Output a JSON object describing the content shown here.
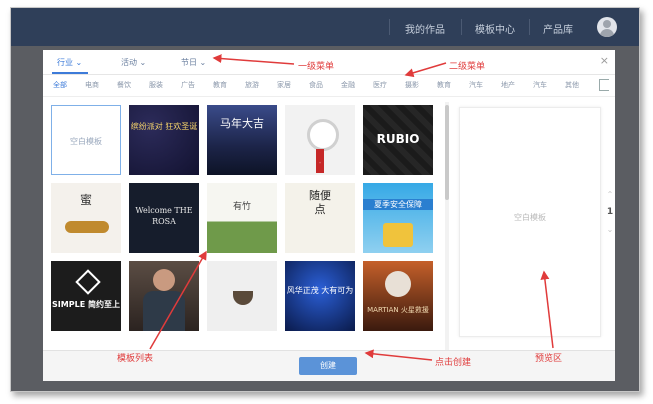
{
  "topnav": {
    "items": [
      "我的作品",
      "模板中心",
      "产品库"
    ],
    "colors": {
      "bg": "#2f3f59",
      "text": "#c7d0dd"
    }
  },
  "modal": {
    "tabs": [
      {
        "label": "行业",
        "arrow": "⌄"
      },
      {
        "label": "活动",
        "arrow": "⌄"
      },
      {
        "label": "节日",
        "arrow": "⌄"
      }
    ],
    "close": "×",
    "categories": [
      "全部",
      "电商",
      "餐饮",
      "服装",
      "广告",
      "教育",
      "旅游",
      "家居",
      "食品",
      "金融",
      "医疗",
      "摄影",
      "教育",
      "汽车",
      "地产",
      "汽车",
      "其他"
    ],
    "templates": [
      {
        "caption": "空白模板"
      },
      {
        "caption": "缤纷派对 狂欢圣诞"
      },
      {
        "caption": "马年大吉"
      },
      {
        "caption": "手表"
      },
      {
        "caption": "RUBIO"
      },
      {
        "caption": "蜜"
      },
      {
        "caption": "Welcome THE ROSA"
      },
      {
        "caption": "有竹"
      },
      {
        "caption": "随便点"
      },
      {
        "caption": "夏季安全保障"
      },
      {
        "caption": "SIMPLE 简约至上"
      },
      {
        "caption": "人物"
      },
      {
        "caption": "茶"
      },
      {
        "caption": "风华正茂 大有可为"
      },
      {
        "caption": "MARTIAN 火星救援"
      }
    ],
    "preview_label": "空白模板",
    "pager": {
      "up": "⌃",
      "page": "1",
      "down": "⌄"
    },
    "create_label": "创建",
    "accent": "#3d7bd9"
  },
  "annotations": {
    "first_menu": "一级菜单",
    "second_menu": "二级菜单",
    "template_list": "模板列表",
    "click_create": "点击创建",
    "preview_area": "预览区"
  }
}
